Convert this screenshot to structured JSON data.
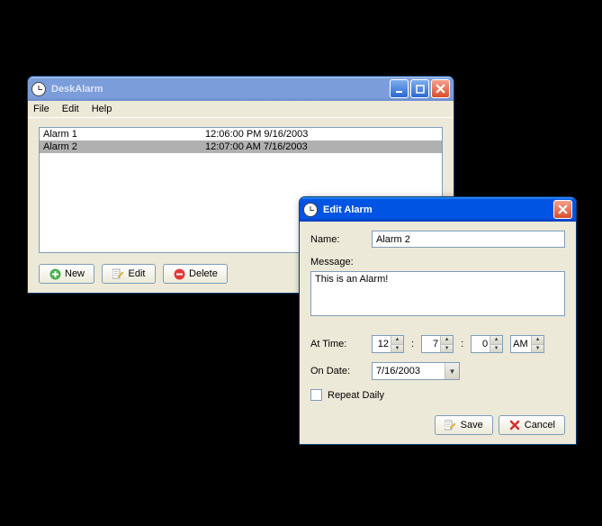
{
  "main": {
    "title": "DeskAlarm",
    "menu": {
      "file": "File",
      "edit": "Edit",
      "help": "Help"
    },
    "alarms": [
      {
        "name": "Alarm 1",
        "time": "12:06:00 PM 9/16/2003",
        "selected": false
      },
      {
        "name": "Alarm 2",
        "time": "12:07:00 AM 7/16/2003",
        "selected": true
      }
    ],
    "buttons": {
      "new": "New",
      "edit": "Edit",
      "delete": "Delete"
    }
  },
  "dialog": {
    "title": "Edit Alarm",
    "labels": {
      "name": "Name:",
      "message": "Message:",
      "at_time": "At Time:",
      "on_date": "On Date:",
      "repeat": "Repeat Daily"
    },
    "values": {
      "name": "Alarm 2",
      "message": "This is an Alarm!",
      "hour": "12",
      "minute": "7",
      "second": "0",
      "ampm": "AM",
      "date": "7/16/2003",
      "repeat_checked": false
    },
    "buttons": {
      "save": "Save",
      "cancel": "Cancel"
    }
  }
}
